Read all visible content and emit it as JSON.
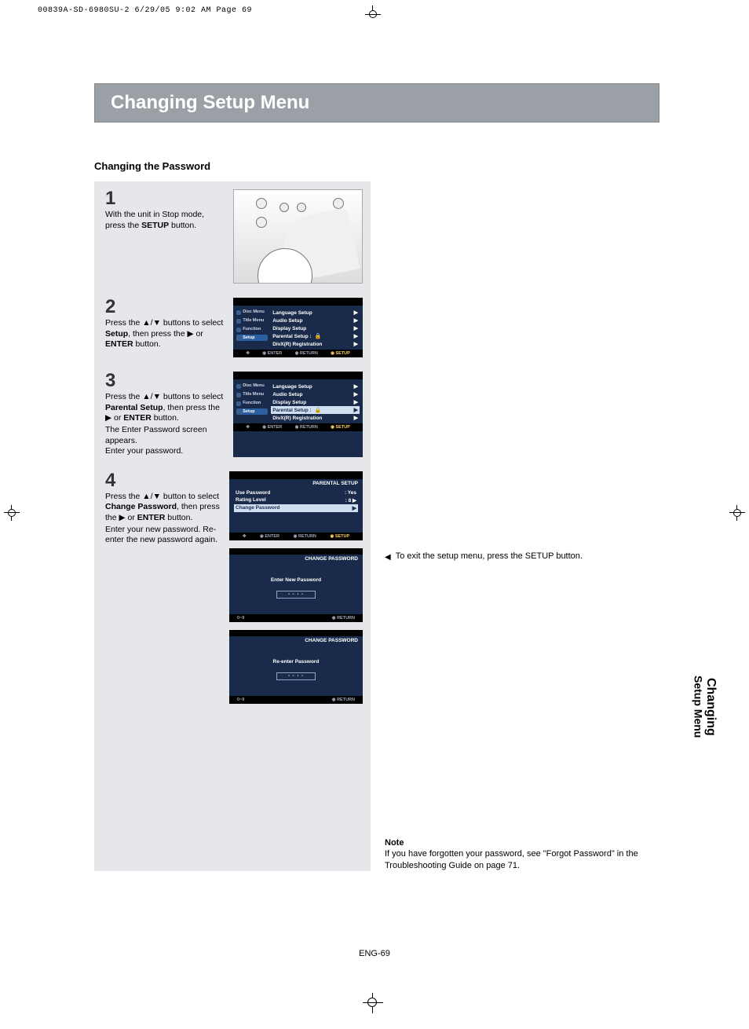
{
  "printline": "00839A-SD-6980SU-2  6/29/05  9:02 AM  Page 69",
  "title_bar": "Changing Setup Menu",
  "subheading": "Changing the Password",
  "steps": {
    "s1": {
      "num": "1",
      "text_pre": "With the unit in Stop mode, press the ",
      "text_bold": "SETUP",
      "text_post": " button."
    },
    "s2": {
      "num": "2",
      "text_a": "Press the ▲/▼ buttons to select ",
      "text_b": "Setup",
      "text_c": ", then press the ▶ or ",
      "text_d": "ENTER",
      "text_e": " button."
    },
    "s3": {
      "num": "3",
      "l1a": "Press the ▲/▼ buttons to select ",
      "l1b": "Parental Setup",
      "l1c": ", then press the ▶ or ",
      "l1d": "ENTER",
      "l1e": " button.",
      "l2": "The Enter Password screen appears.",
      "l3": "Enter your password."
    },
    "s4": {
      "num": "4",
      "l1a": "Press the ▲/▼ button to select ",
      "l1b": "Change Password",
      "l1c": ", then press the ▶ or ",
      "l1d": "ENTER",
      "l1e": " button.",
      "l2": "Enter your new password. Re-enter the new password again."
    }
  },
  "osd": {
    "side": {
      "disc": "Disc Menu",
      "title": "Title Menu",
      "func": "Function",
      "setup": "Setup"
    },
    "menu": {
      "lang": "Language Setup",
      "audio": "Audio Setup",
      "display": "Display Setup",
      "parental": "Parental Setup  :",
      "divx": "DivX(R) Registration"
    },
    "footer": {
      "enter": "ENTER",
      "return": "RETURN",
      "setup": "SETUP"
    },
    "parental_title": "PARENTAL SETUP",
    "parental_rows": {
      "use": "Use Password",
      "use_v": ": Yes",
      "rating": "Rating Level",
      "rating_v": ": 8",
      "change": "Change Password"
    },
    "cpw_title": "CHANGE PASSWORD",
    "cpw_enter": "Enter New Password",
    "cpw_reenter": "Re-enter Password",
    "dashes": "- - - -",
    "numpad": "0~9"
  },
  "exit_note": {
    "tri": "◀",
    "text": "To exit the setup menu, press the SETUP button."
  },
  "note": {
    "h": "Note",
    "body": "If you have forgotten your password, see \"Forgot Password\" in the Troubleshooting Guide on page 71."
  },
  "sidetab": {
    "l1": "Changing",
    "l2": "Setup Menu"
  },
  "pagenum": "ENG-69"
}
